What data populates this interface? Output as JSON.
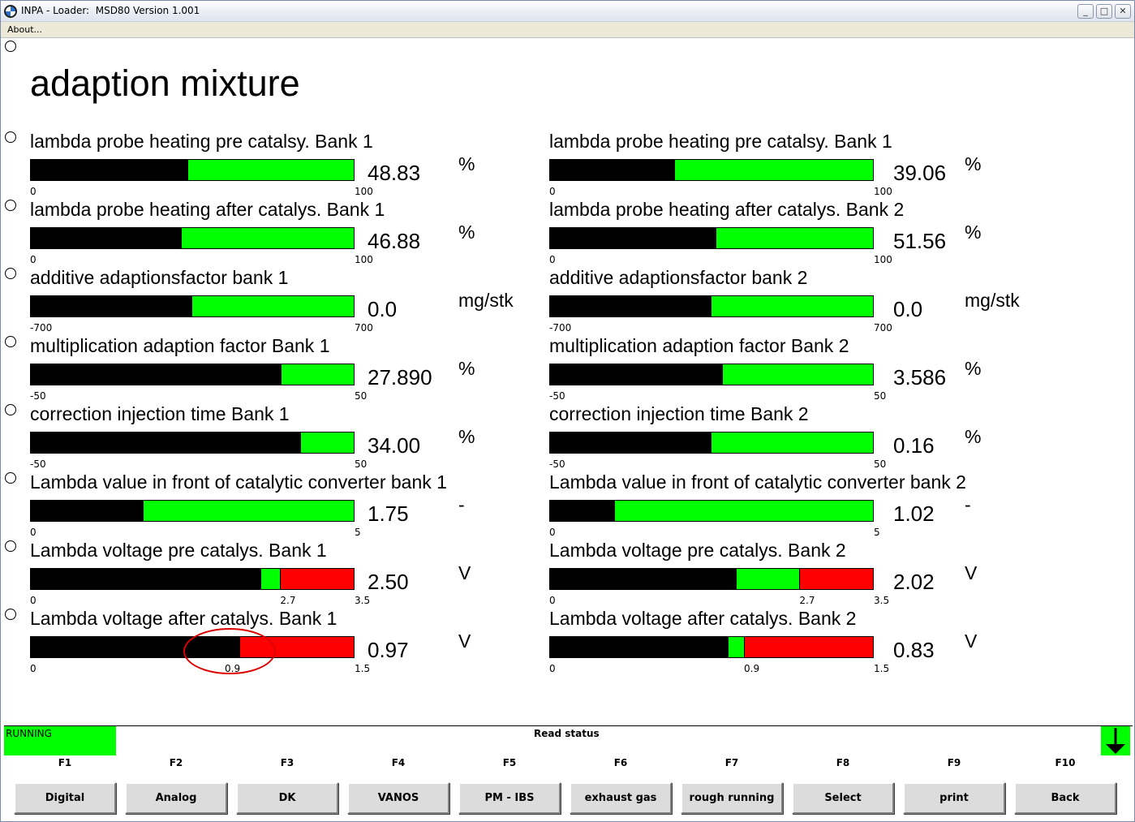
{
  "window": {
    "title": "INPA - Loader:  MSD80 Version 1.001",
    "min": "_",
    "max": "□",
    "close": "✕"
  },
  "menu": {
    "about": "About..."
  },
  "page_title": "adaption mixture",
  "colors": {
    "bar_bg": "#00ff00",
    "bar_fill": "#000000",
    "bar_limit": "#ff0000",
    "status_green": "#00ff00",
    "annotation": "#dd0000"
  },
  "rows": [
    {
      "left": {
        "label": "lambda probe heating pre catalsy. Bank 1",
        "value": "48.83",
        "unit": "%",
        "min": "0",
        "max": "100",
        "fill": 0.487,
        "limit": null
      },
      "right": {
        "label": "lambda probe heating pre catalsy. Bank 1",
        "value": "39.06",
        "unit": "%",
        "min": "0",
        "max": "100",
        "fill": 0.387,
        "limit": null
      }
    },
    {
      "left": {
        "label": "lambda probe heating after catalys. Bank 1",
        "value": "46.88",
        "unit": "%",
        "min": "0",
        "max": "100",
        "fill": 0.467,
        "limit": null
      },
      "right": {
        "label": "lambda probe heating after catalys. Bank 2",
        "value": "51.56",
        "unit": "%",
        "min": "0",
        "max": "100",
        "fill": 0.515,
        "limit": null
      }
    },
    {
      "left": {
        "label": "additive adaptionsfactor bank 1",
        "value": "0.0",
        "unit": "mg/stk",
        "min": "-700",
        "max": "700",
        "fill": 0.5,
        "limit": null
      },
      "right": {
        "label": "additive adaptionsfactor bank 2",
        "value": "0.0",
        "unit": "mg/stk",
        "min": "-700",
        "max": "700",
        "fill": 0.5,
        "limit": null
      }
    },
    {
      "left": {
        "label": "multiplication adaption factor Bank 1",
        "value": "27.890",
        "unit": "%",
        "min": "-50",
        "max": "50",
        "fill": 0.777,
        "limit": null
      },
      "right": {
        "label": "multiplication adaption factor Bank 2",
        "value": "3.586",
        "unit": "%",
        "min": "-50",
        "max": "50",
        "fill": 0.535,
        "limit": null
      }
    },
    {
      "left": {
        "label": "correction injection time Bank 1",
        "value": "34.00",
        "unit": "%",
        "min": "-50",
        "max": "50",
        "fill": 0.837,
        "limit": null
      },
      "right": {
        "label": "correction injection time Bank 2",
        "value": "0.16",
        "unit": "%",
        "min": "-50",
        "max": "50",
        "fill": 0.5,
        "limit": null
      }
    },
    {
      "left": {
        "label": "Lambda value in front of catalytic converter bank 1",
        "value": "1.75",
        "unit": "-",
        "min": "0",
        "max": "5",
        "fill": 0.35,
        "limit": null
      },
      "right": {
        "label": "Lambda value in front of catalytic converter bank 2",
        "value": "1.02",
        "unit": "-",
        "min": "0",
        "max": "5",
        "fill": 0.2,
        "limit": null
      }
    },
    {
      "left": {
        "label": "Lambda voltage pre catalys. Bank 1",
        "value": "2.50",
        "unit": "V",
        "min": "0",
        "max": "3.5",
        "fill": 0.714,
        "limit": 0.771,
        "limit_label": "2.7"
      },
      "right": {
        "label": "Lambda voltage pre catalys. Bank 2",
        "value": "2.02",
        "unit": "V",
        "min": "0",
        "max": "3.5",
        "fill": 0.577,
        "limit": 0.771,
        "limit_label": "2.7"
      }
    },
    {
      "left": {
        "label": "Lambda voltage after catalys. Bank 1",
        "value": "0.97",
        "unit": "V",
        "min": "0",
        "max": "1.5",
        "fill": 0.647,
        "limit": 0.6,
        "limit_label": "0.9"
      },
      "right": {
        "label": "Lambda voltage after catalys. Bank 2",
        "value": "0.83",
        "unit": "V",
        "min": "0",
        "max": "1.5",
        "fill": 0.553,
        "limit": 0.6,
        "limit_label": "0.9"
      }
    }
  ],
  "status": {
    "running": "RUNNING",
    "text": "Read status"
  },
  "fkeys": [
    {
      "key": "F1",
      "label": "Digital"
    },
    {
      "key": "F2",
      "label": "Analog"
    },
    {
      "key": "F3",
      "label": "DK"
    },
    {
      "key": "F4",
      "label": "VANOS"
    },
    {
      "key": "F5",
      "label": "PM - IBS"
    },
    {
      "key": "F6",
      "label": "exhaust gas"
    },
    {
      "key": "F7",
      "label": "rough running"
    },
    {
      "key": "F8",
      "label": "Select"
    },
    {
      "key": "F9",
      "label": "print"
    },
    {
      "key": "F10",
      "label": "Back"
    }
  ]
}
